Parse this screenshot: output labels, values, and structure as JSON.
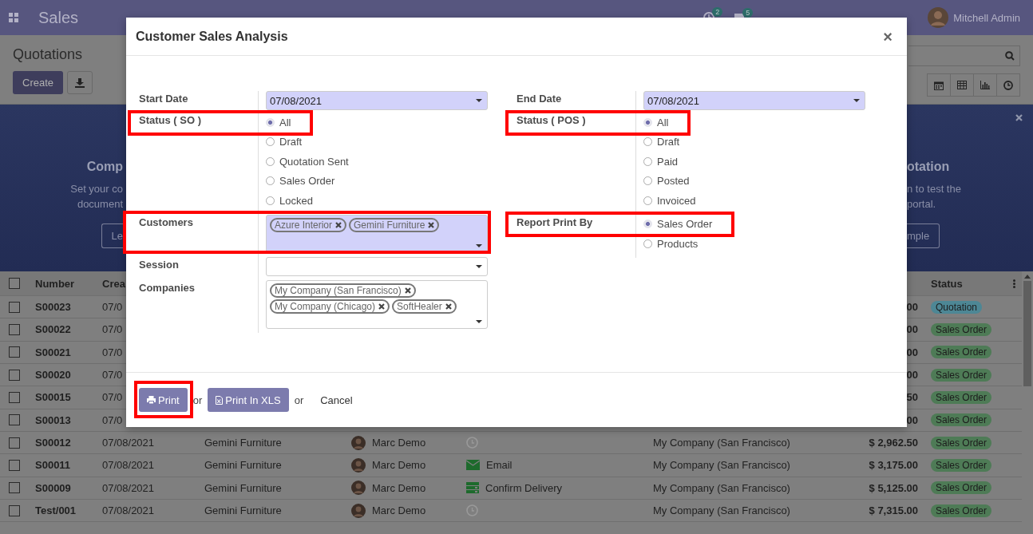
{
  "navbar": {
    "app_name": "Sales",
    "activity_count": "2",
    "message_count": "5",
    "user": "Mitchell Admin"
  },
  "control_panel": {
    "title": "Quotations",
    "create_label": "Create"
  },
  "banner": {
    "left_title": "Comp",
    "left_lines": [
      "Set your co",
      "document"
    ],
    "left_button": "Le",
    "right_title": "otation",
    "right_lines": [
      "n to test the",
      "portal."
    ],
    "right_button": "mple"
  },
  "table": {
    "all_checked": false,
    "columns": [
      "Number",
      "Crea",
      "Status"
    ],
    "rows": [
      {
        "checked": false,
        "number": "S00023",
        "date": "07/0",
        "amount": "00",
        "status": "Quotation",
        "color": "#4d8795"
      },
      {
        "checked": false,
        "number": "S00022",
        "date": "07/0",
        "amount": "00",
        "status": "Sales Order",
        "color": "#4e7b56"
      },
      {
        "checked": false,
        "number": "S00021",
        "date": "07/0",
        "amount": "00",
        "status": "Sales Order",
        "color": "#4e7b56"
      },
      {
        "checked": false,
        "number": "S00020",
        "date": "07/0",
        "amount": "00",
        "status": "Sales Order",
        "color": "#4e7b56"
      },
      {
        "checked": false,
        "number": "S00015",
        "date": "07/0",
        "amount": "50",
        "status": "Sales Order",
        "color": "#4e7b56"
      },
      {
        "checked": false,
        "number": "S00013",
        "date": "07/0",
        "amount": "00",
        "status": "Sales Order",
        "color": "#4e7b56"
      },
      {
        "checked": false,
        "number": "S00012",
        "date": "07/08/2021",
        "customer": "Gemini Furniture",
        "salesperson": "Marc Demo",
        "kind": "none",
        "company": "My Company (San Francisco)",
        "amount": "$ 2,962.50",
        "status": "Sales Order",
        "color": "#4e7b56"
      },
      {
        "checked": false,
        "number": "S00011",
        "date": "07/08/2021",
        "customer": "Gemini Furniture",
        "salesperson": "Marc Demo",
        "kind": "email",
        "activity": "Email",
        "company": "My Company (San Francisco)",
        "amount": "$ 3,175.00",
        "status": "Sales Order",
        "color": "#4e7b56"
      },
      {
        "checked": false,
        "number": "S00009",
        "date": "07/08/2021",
        "customer": "Gemini Furniture",
        "salesperson": "Marc Demo",
        "kind": "todo",
        "activity": "Confirm Delivery",
        "company": "My Company (San Francisco)",
        "amount": "$ 5,125.00",
        "status": "Sales Order",
        "color": "#4e7b56"
      },
      {
        "checked": false,
        "number": "Test/001",
        "date": "07/08/2021",
        "customer": "Gemini Furniture",
        "salesperson": "Marc Demo",
        "kind": "none",
        "company": "My Company (San Francisco)",
        "amount": "$ 7,315.00",
        "status": "Sales Order",
        "color": "#4e7b56"
      }
    ]
  },
  "dialog": {
    "title": "Customer Sales Analysis",
    "close": "×",
    "left_fields": [
      {
        "kind": "date",
        "label": "Start Date",
        "value": "07/08/2021",
        "required": true
      },
      {
        "kind": "radio",
        "label": "Status ( SO )",
        "highlighted": true,
        "options": [
          {
            "label": "All",
            "selected": true
          },
          {
            "label": "Draft",
            "selected": false
          },
          {
            "label": "Quotation Sent",
            "selected": false
          },
          {
            "label": "Sales Order",
            "selected": false
          },
          {
            "label": "Locked",
            "selected": false
          }
        ]
      },
      {
        "kind": "tags",
        "label": "Customers",
        "required": true,
        "highlighted": true,
        "tags": [
          "Azure Interior",
          "Gemini Furniture"
        ]
      },
      {
        "kind": "select",
        "label": "Session",
        "required": false
      },
      {
        "kind": "tags",
        "label": "Companies",
        "required": false,
        "tags": [
          "My Company (San Francisco)",
          "My Company (Chicago)",
          "SoftHealer"
        ]
      }
    ],
    "right_fields": [
      {
        "kind": "date",
        "label": "End Date",
        "value": "07/08/2021",
        "required": true
      },
      {
        "kind": "radio",
        "label": "Status ( POS )",
        "highlighted": true,
        "options": [
          {
            "label": "All",
            "selected": true
          },
          {
            "label": "Draft",
            "selected": false
          },
          {
            "label": "Paid",
            "selected": false
          },
          {
            "label": "Posted",
            "selected": false
          },
          {
            "label": "Invoiced",
            "selected": false
          }
        ]
      },
      {
        "kind": "radio",
        "label": "Report Print By",
        "highlighted": true,
        "options": [
          {
            "label": "Sales Order",
            "selected": true
          },
          {
            "label": "Products",
            "selected": false
          }
        ]
      }
    ],
    "print_label": "Print",
    "print_highlighted": true,
    "or_1": "or",
    "xls_label": "Print In XLS",
    "or_2": "or",
    "cancel_label": "Cancel"
  }
}
